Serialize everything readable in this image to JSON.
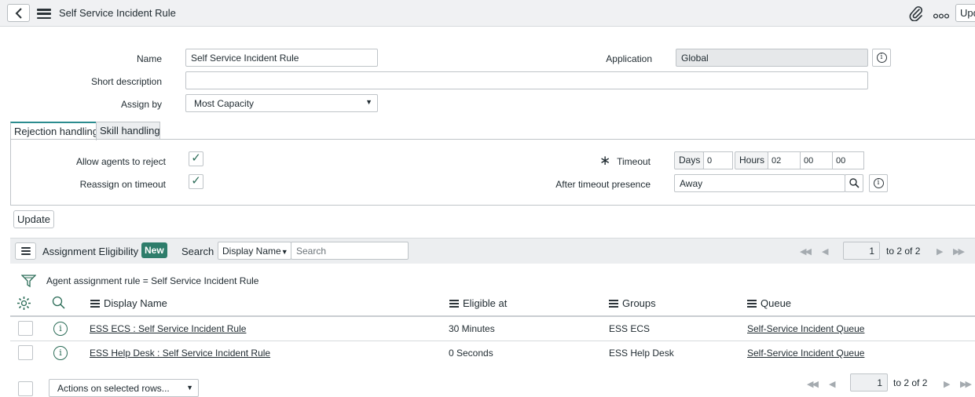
{
  "header": {
    "title": "Self Service Incident Rule",
    "update_label": "Update"
  },
  "form": {
    "name_label": "Name",
    "name_value": "Self Service Incident Rule",
    "application_label": "Application",
    "application_value": "Global",
    "short_description_label": "Short description",
    "short_description_value": "",
    "assign_by_label": "Assign by",
    "assign_by_value": "Most Capacity"
  },
  "tabs": [
    {
      "label": "Rejection handling",
      "active": true
    },
    {
      "label": "Skill handling",
      "active": false
    }
  ],
  "rejection": {
    "allow_reject_label": "Allow agents to reject",
    "allow_reject_checked": true,
    "reassign_label": "Reassign on timeout",
    "reassign_checked": true,
    "timeout_label": "Timeout",
    "days_label": "Days",
    "days_value": "0",
    "hours_label": "Hours",
    "hours_value": "02",
    "minutes_value": "00",
    "seconds_value": "00",
    "after_timeout_label": "After timeout presence",
    "after_timeout_value": "Away"
  },
  "update_button": "Update",
  "list": {
    "title": "Assignment Eligibility",
    "new_label": "New",
    "search_label": "Search",
    "search_field": "Display Name",
    "search_placeholder": "Search",
    "page": "1",
    "page_total": "to 2 of 2",
    "filter_text": "Agent assignment rule = Self Service Incident Rule",
    "columns": [
      "Display Name",
      "Eligible at",
      "Groups",
      "Queue"
    ],
    "rows": [
      {
        "display_name": "ESS ECS : Self Service Incident Rule",
        "eligible_at": "30 Minutes",
        "groups": "ESS ECS",
        "queue": "Self-Service Incident Queue"
      },
      {
        "display_name": "ESS Help Desk : Self Service Incident Rule",
        "eligible_at": "0 Seconds",
        "groups": "ESS Help Desk",
        "queue": "Self-Service Incident Queue"
      }
    ],
    "actions_label": "Actions on selected rows...",
    "footer_page": "1",
    "footer_total": "to 2 of 2"
  },
  "icons": [
    "back-icon",
    "menu-icon",
    "paperclip-icon",
    "more-icon",
    "info-icon",
    "search-icon",
    "filter-icon",
    "gear-icon",
    "check-icon"
  ],
  "colors": {
    "accent": "#2b8c8f",
    "new_button": "#2e7d6b",
    "header_bg": "#f0f1f3"
  }
}
